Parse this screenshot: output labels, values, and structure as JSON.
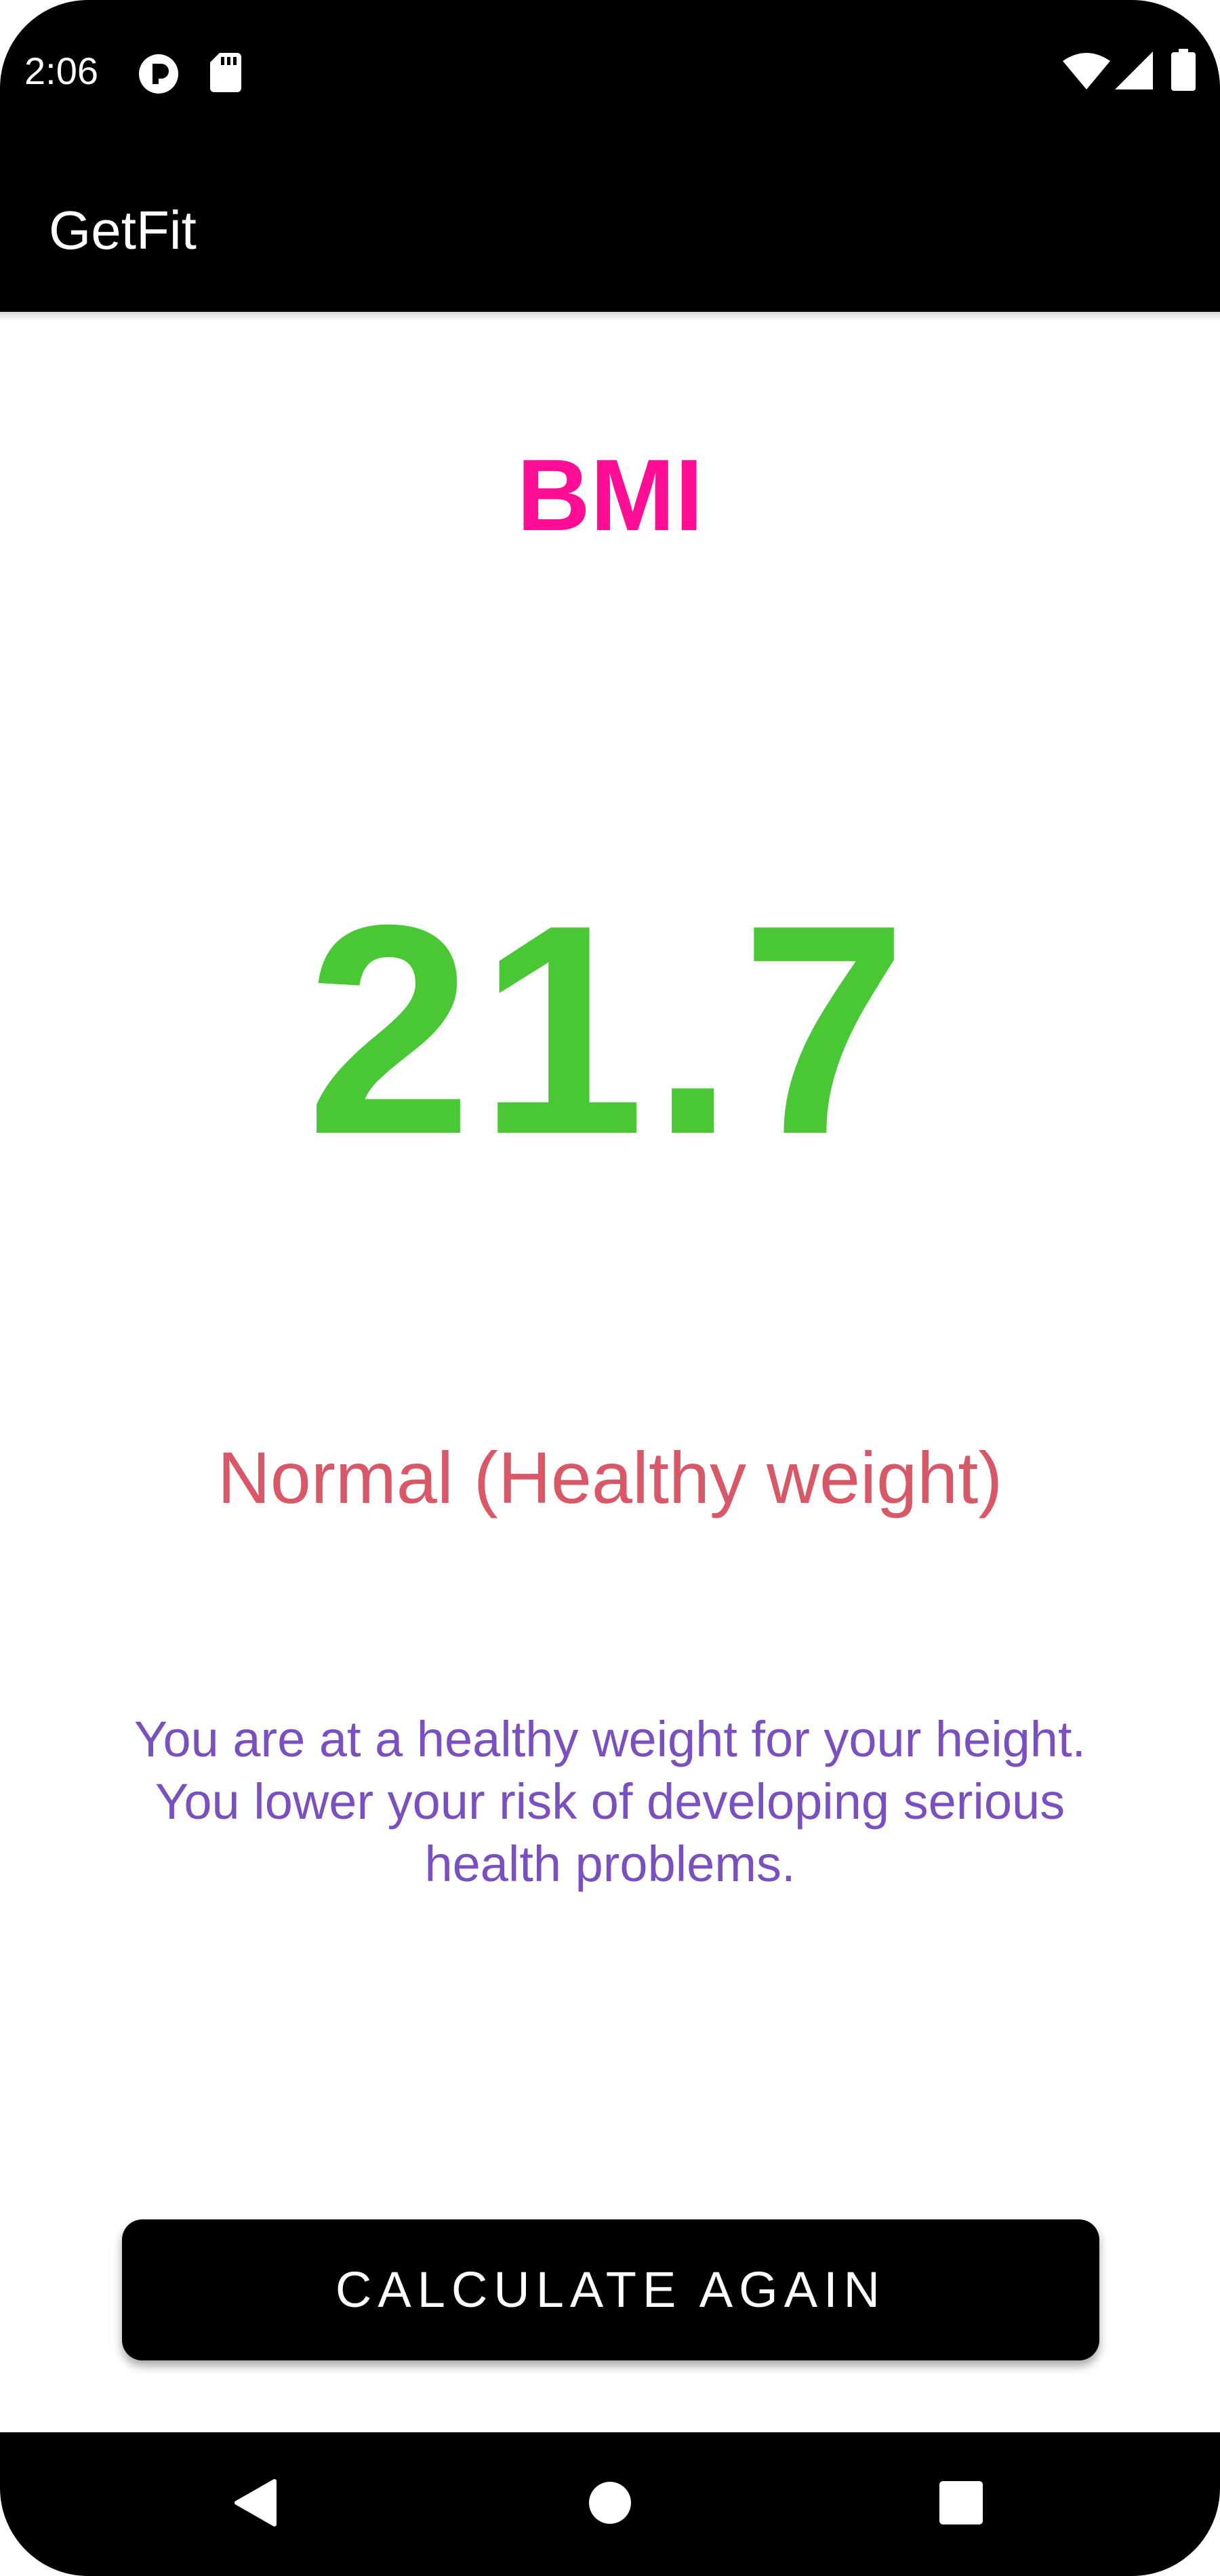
{
  "status_bar": {
    "time": "2:06",
    "left_icons": [
      "notification-app-icon",
      "sd-card-icon"
    ],
    "right_icons": [
      "wifi-icon",
      "cell-signal-icon",
      "battery-icon"
    ]
  },
  "app_bar": {
    "title": "GetFit"
  },
  "result": {
    "label": "BMI",
    "value": "21.7",
    "category": "Normal (Healthy weight)",
    "description": "You are at a healthy weight for your height. You lower your risk of developing serious health problems."
  },
  "actions": {
    "calculate_again_label": "CALCULATE AGAIN"
  },
  "nav_bar": {
    "buttons": [
      "back-icon",
      "home-icon",
      "recents-icon"
    ]
  },
  "colors": {
    "bmi_label": "#ff0d94",
    "bmi_value": "#4ac734",
    "category": "#d95868",
    "description": "#7a4fc0",
    "bars": "#000000"
  }
}
